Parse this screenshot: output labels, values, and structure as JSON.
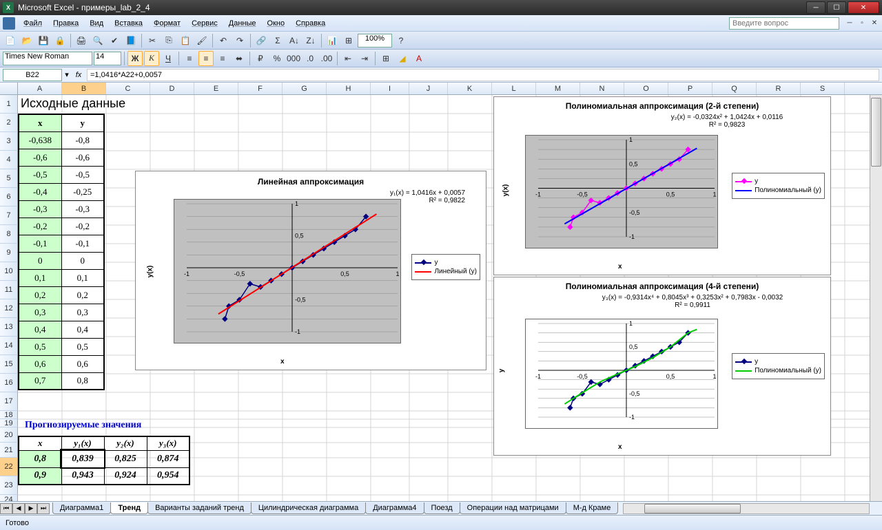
{
  "window": {
    "title": "Microsoft Excel - примеры_lab_2_4"
  },
  "menu": {
    "items": [
      "Файл",
      "Правка",
      "Вид",
      "Вставка",
      "Формат",
      "Сервис",
      "Данные",
      "Окно",
      "Справка"
    ],
    "question_placeholder": "Введите вопрос"
  },
  "toolbar2": {
    "font": "Times New Roman",
    "size": "14",
    "zoom": "100%"
  },
  "formula": {
    "namebox": "B22",
    "formula": "=1,0416*A22+0,0057"
  },
  "columns": [
    "A",
    "B",
    "C",
    "D",
    "E",
    "F",
    "G",
    "H",
    "I",
    "J",
    "K",
    "L",
    "M",
    "N",
    "O",
    "P",
    "Q",
    "R",
    "S"
  ],
  "section_header": "Исходные данные",
  "data_headers": {
    "x": "x",
    "y": "y"
  },
  "data_rows": [
    {
      "x": "-0,638",
      "y": "-0,8"
    },
    {
      "x": "-0,6",
      "y": "-0,6"
    },
    {
      "x": "-0,5",
      "y": "-0,5"
    },
    {
      "x": "-0,4",
      "y": "-0,25"
    },
    {
      "x": "-0,3",
      "y": "-0,3"
    },
    {
      "x": "-0,2",
      "y": "-0,2"
    },
    {
      "x": "-0,1",
      "y": "-0,1"
    },
    {
      "x": "0",
      "y": "0"
    },
    {
      "x": "0,1",
      "y": "0,1"
    },
    {
      "x": "0,2",
      "y": "0,2"
    },
    {
      "x": "0,3",
      "y": "0,3"
    },
    {
      "x": "0,4",
      "y": "0,4"
    },
    {
      "x": "0,5",
      "y": "0,5"
    },
    {
      "x": "0,6",
      "y": "0,6"
    },
    {
      "x": "0,7",
      "y": "0,8"
    }
  ],
  "forecast_header": "Прогнозируемые значения",
  "forecast_cols": [
    "x",
    "y₁(x)",
    "y₂(x)",
    "y₃(x)"
  ],
  "forecast_rows": [
    {
      "x": "0,8",
      "y1": "0,839",
      "y2": "0,825",
      "y3": "0,874"
    },
    {
      "x": "0,9",
      "y1": "0,943",
      "y2": "0,924",
      "y3": "0,954"
    }
  ],
  "chart1": {
    "title": "Линейная аппроксимация",
    "eq": "y₁(x) = 1,0416x + 0,0057",
    "r2": "R² = 0,9822",
    "xlabel": "x",
    "ylabel": "y(x)",
    "legend": [
      "y",
      "Линейный (y)"
    ]
  },
  "chart2": {
    "title": "Полиномиальная аппроксимация (2-й степени)",
    "eq": "y₂(x) = -0,0324x² + 1,0424x + 0,0116",
    "r2": "R² = 0,9823",
    "xlabel": "x",
    "ylabel": "y(x)",
    "legend": [
      "y",
      "Полиномиальный (y)"
    ]
  },
  "chart3": {
    "title": "Полиномиальная аппроксимация  (4-й степени)",
    "eq": "y₃(x) = -0,9314x⁴ + 0,8045x³ + 0,3253x² + 0,7983x - 0,0032",
    "r2": "R² = 0,9911",
    "xlabel": "x",
    "ylabel": "y",
    "legend": [
      "y",
      "Полиномиальный (y)"
    ]
  },
  "chart_data": [
    {
      "type": "scatter",
      "title": "Линейная аппроксимация",
      "xlabel": "x",
      "ylabel": "y(x)",
      "xlim": [
        -1,
        1
      ],
      "ylim": [
        -1,
        1
      ],
      "series": [
        {
          "name": "y",
          "x": [
            -0.638,
            -0.6,
            -0.5,
            -0.4,
            -0.3,
            -0.2,
            -0.1,
            0,
            0.1,
            0.2,
            0.3,
            0.4,
            0.5,
            0.6,
            0.7
          ],
          "y": [
            -0.8,
            -0.6,
            -0.5,
            -0.25,
            -0.3,
            -0.2,
            -0.1,
            0,
            0.1,
            0.2,
            0.3,
            0.4,
            0.5,
            0.6,
            0.8
          ]
        },
        {
          "name": "Линейный (y)",
          "type": "line",
          "x": [
            -0.7,
            0.8
          ],
          "y": [
            -0.723,
            0.839
          ]
        }
      ]
    },
    {
      "type": "scatter",
      "title": "Полиномиальная аппроксимация (2-й степени)",
      "xlabel": "x",
      "ylabel": "y(x)",
      "xlim": [
        -1,
        1
      ],
      "ylim": [
        -1,
        1
      ],
      "series": [
        {
          "name": "y",
          "x": [
            -0.638,
            -0.6,
            -0.5,
            -0.4,
            -0.3,
            -0.2,
            -0.1,
            0,
            0.1,
            0.2,
            0.3,
            0.4,
            0.5,
            0.6,
            0.7
          ],
          "y": [
            -0.8,
            -0.6,
            -0.5,
            -0.25,
            -0.3,
            -0.2,
            -0.1,
            0,
            0.1,
            0.2,
            0.3,
            0.4,
            0.5,
            0.6,
            0.8
          ]
        },
        {
          "name": "Полиномиальный (y)",
          "type": "line",
          "x": [
            -0.7,
            0.8
          ],
          "y": [
            -0.734,
            0.825
          ]
        }
      ]
    },
    {
      "type": "scatter",
      "title": "Полиномиальная аппроксимация (4-й степени)",
      "xlabel": "x",
      "ylabel": "y",
      "xlim": [
        -1,
        1
      ],
      "ylim": [
        -1,
        1
      ],
      "series": [
        {
          "name": "y",
          "x": [
            -0.638,
            -0.6,
            -0.5,
            -0.4,
            -0.3,
            -0.2,
            -0.1,
            0,
            0.1,
            0.2,
            0.3,
            0.4,
            0.5,
            0.6,
            0.7
          ],
          "y": [
            -0.8,
            -0.6,
            -0.5,
            -0.25,
            -0.3,
            -0.2,
            -0.1,
            0,
            0.1,
            0.2,
            0.3,
            0.4,
            0.5,
            0.6,
            0.8
          ]
        },
        {
          "name": "Полиномиальный (y)",
          "type": "line",
          "x": [
            -0.7,
            -0.5,
            -0.3,
            -0.1,
            0.1,
            0.3,
            0.5,
            0.7,
            0.8
          ],
          "y": [
            -0.72,
            -0.48,
            -0.25,
            -0.08,
            0.08,
            0.27,
            0.5,
            0.8,
            0.874
          ]
        }
      ]
    }
  ],
  "tabs": [
    "Диаграмма1",
    "Тренд",
    "Варианты заданий тренд",
    "Цилиндрическая диаграмма",
    "Диаграмма4",
    "Поезд",
    "Операции над матрицами",
    "М-д Краме"
  ],
  "active_tab": "Тренд",
  "status": "Готово"
}
